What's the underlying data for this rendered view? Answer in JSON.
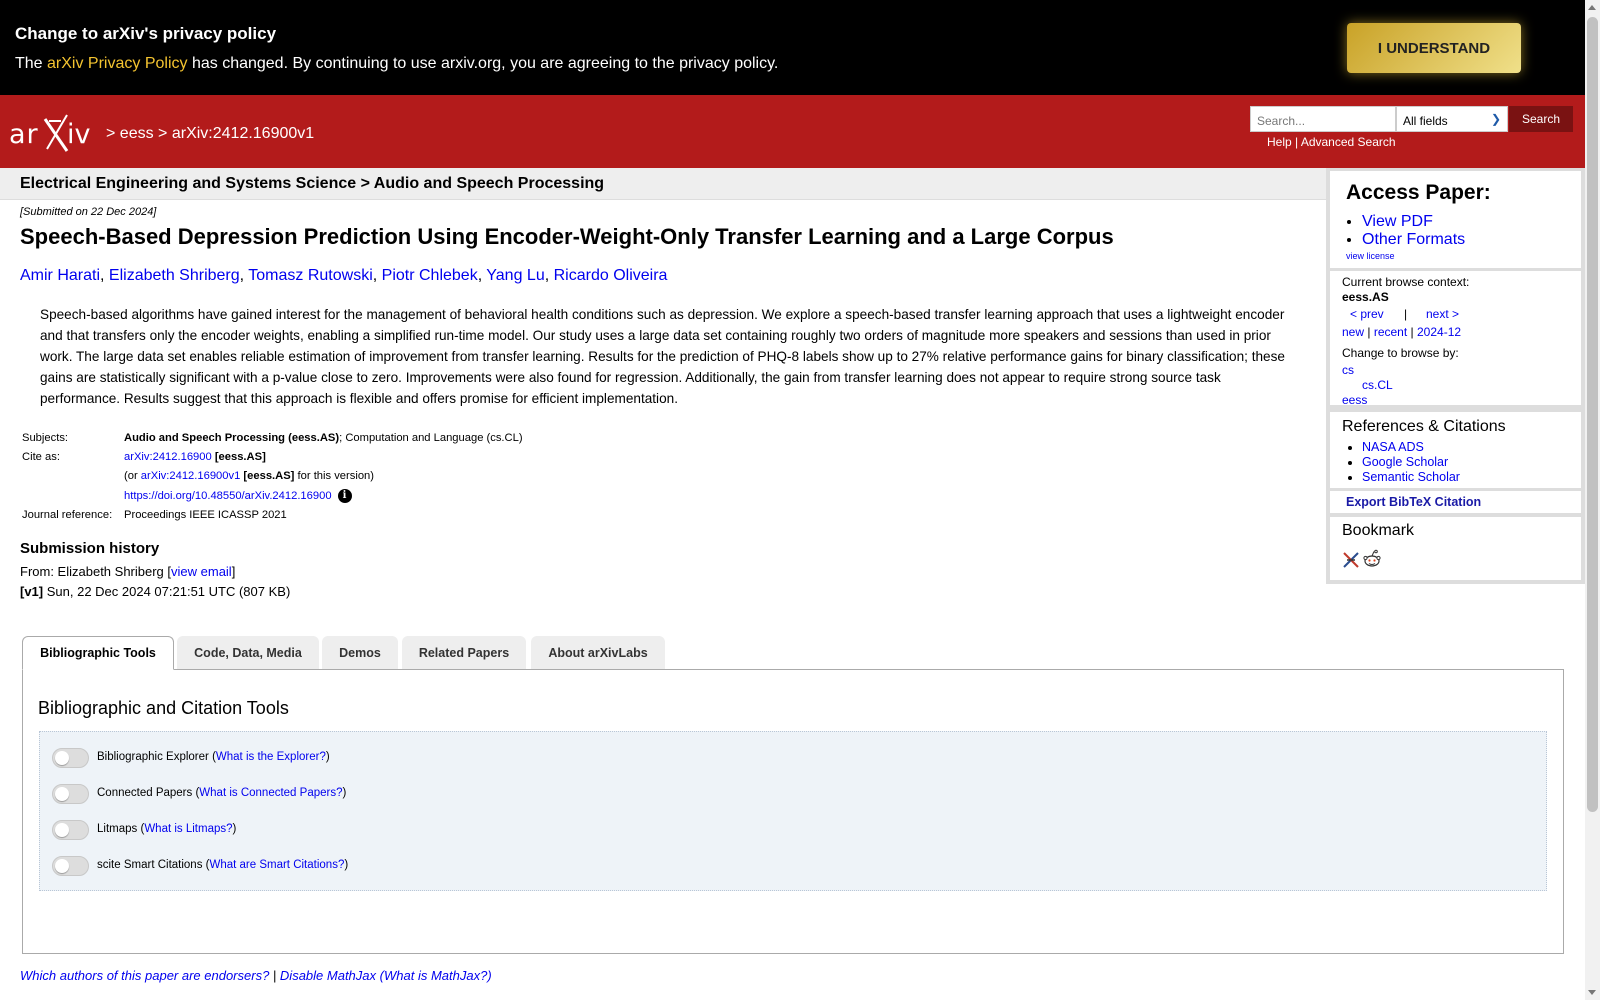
{
  "banner": {
    "title": "Change to arXiv's privacy policy",
    "text_before": "The ",
    "link": "arXiv Privacy Policy",
    "text_after": " has changed. By continuing to use arxiv.org, you are agreeing to the privacy policy.",
    "button": "I UNDERSTAND"
  },
  "header": {
    "logo_alt": "arXiv",
    "crumb1": "eess",
    "crumb2": "arXiv:2412.16900v1",
    "crumb_sep": ">",
    "search_placeholder": "Search...",
    "field_select": "All fields",
    "search_button": "Search",
    "help": "Help",
    "help_sep": "|",
    "advanced": "Advanced Search"
  },
  "subject_strip": "Electrical Engineering and Systems Science > Audio and Speech Processing",
  "submitted": "[Submitted on 22 Dec 2024]",
  "title": "Speech-Based Depression Prediction Using Encoder-Weight-Only Transfer Learning and a Large Corpus",
  "authors": [
    "Amir Harati",
    "Elizabeth Shriberg",
    "Tomasz Rutowski",
    "Piotr Chlebek",
    "Yang Lu",
    "Ricardo Oliveira"
  ],
  "abstract": "Speech-based algorithms have gained interest for the management of behavioral health conditions such as depression. We explore a speech-based transfer learning approach that uses a lightweight encoder and that transfers only the encoder weights, enabling a simplified run-time model. Our study uses a large data set containing roughly two orders of magnitude more speakers and sessions than used in prior work. The large data set enables reliable estimation of improvement from transfer learning. Results for the prediction of PHQ-8 labels show up to 27% relative performance gains for binary classification; these gains are statistically significant with a p-value close to zero. Improvements were also found for regression. Additionally, the gain from transfer learning does not appear to require strong source task performance. Results suggest that this approach is flexible and offers promise for efficient implementation.",
  "meta": {
    "subjects_label": "Subjects:",
    "subjects_primary": "Audio and Speech Processing (eess.AS)",
    "subjects_rest": "; Computation and Language (cs.CL)",
    "cite_label": "Cite as:",
    "cite_id": "arXiv:2412.16900",
    "cite_cat": "[eess.AS]",
    "cite_or": "(or ",
    "cite_version": "arXiv:2412.16900v1",
    "cite_version_cat": "[eess.AS]",
    "cite_version_tail": " for this version)",
    "doi": "https://doi.org/10.48550/arXiv.2412.16900",
    "info": "i",
    "journal_label": "Journal reference:",
    "journal": "Proceedings IEEE ICASSP 2021"
  },
  "history": {
    "title": "Submission history",
    "from_prefix": "From: Elizabeth Shriberg [",
    "view_email": "view email",
    "from_suffix": "]",
    "v1_tag": "[v1]",
    "v1_text": " Sun, 22 Dec 2024 07:21:51 UTC (807 KB)"
  },
  "sidebar": {
    "access_title": "Access Paper:",
    "view_pdf": "View PDF",
    "other_formats": "Other Formats",
    "view_license": "view license",
    "browse_context_label": "Current browse context:",
    "browse_context": "eess.AS",
    "prev": "< prev",
    "pipe": "|",
    "next": "next >",
    "new": "new",
    "recent": "recent",
    "month": "2024-12",
    "change_label": "Change to browse by:",
    "cs": "cs",
    "cs_cl": "cs.CL",
    "eess": "eess",
    "refs_title": "References & Citations",
    "nasa": "NASA ADS",
    "google": "Google Scholar",
    "semantic": "Semantic Scholar",
    "bibtex": "Export BibTeX Citation",
    "bookmark": "Bookmark"
  },
  "tabs": [
    "Bibliographic Tools",
    "Code, Data, Media",
    "Demos",
    "Related Papers",
    "About arXivLabs"
  ],
  "panel_title": "Bibliographic and Citation Tools",
  "tools": [
    {
      "label": "Bibliographic Explorer",
      "link": "What is the Explorer?"
    },
    {
      "label": "Connected Papers",
      "link": "What is Connected Papers?"
    },
    {
      "label": "Litmaps",
      "link": "What is Litmaps?"
    },
    {
      "label": "scite Smart Citations",
      "link": "What are Smart Citations?"
    }
  ],
  "footer": {
    "endorsers": "Which authors of this paper are endorsers?",
    "sep": " | ",
    "disable_mathjax": "Disable MathJax",
    "what_mathjax": "What is MathJax?"
  },
  "colors": {
    "header_red": "#b31b1b",
    "banner_gold": "#f4c430",
    "link_blue": "#0000ee"
  }
}
